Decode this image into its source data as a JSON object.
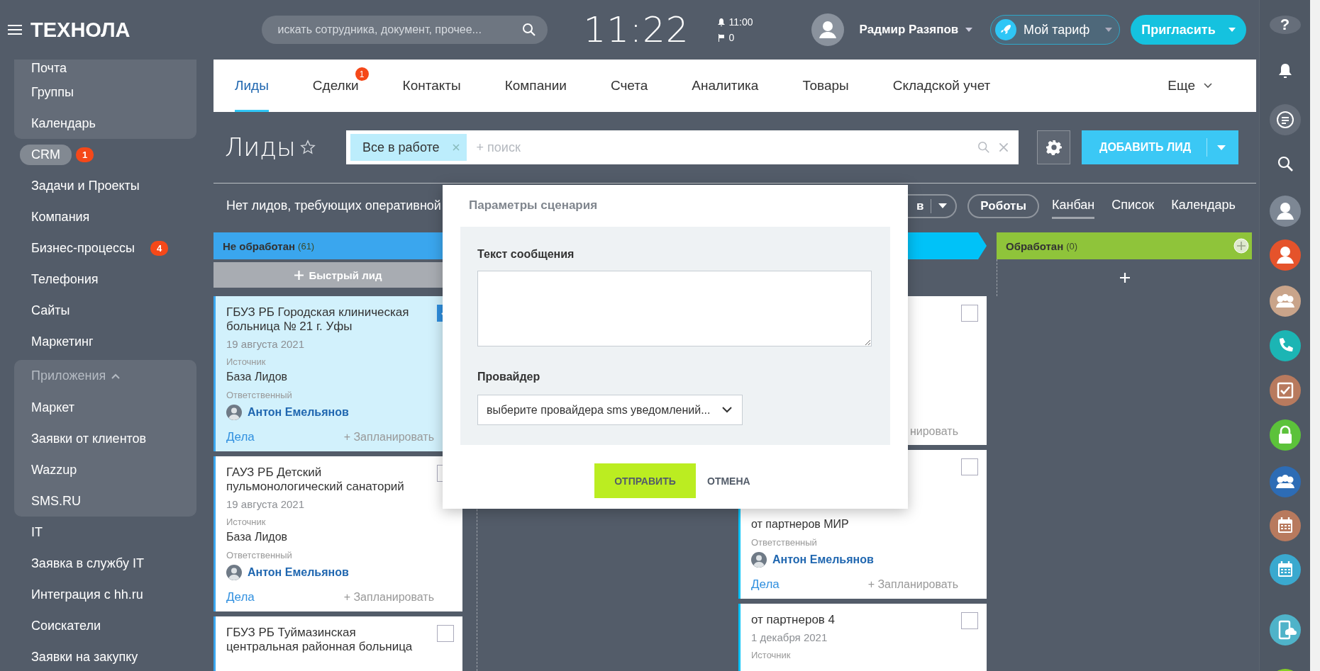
{
  "header": {
    "logo": "ТЕХНОЛА",
    "search": {
      "placeholder": "искать сотрудника, документ, прочее..."
    },
    "clock": "11:22",
    "alarm": "11:00",
    "flags": "0",
    "user": "Радмир Разяпов",
    "tariff": "Мой тариф",
    "invite": "Пригласить",
    "help": "?"
  },
  "sidebar": {
    "sections": [
      {
        "boxed": true,
        "items": [
          {
            "label": "Почта",
            "selected": false
          },
          {
            "label": "Группы",
            "selected": false
          },
          {
            "label": "Календарь",
            "selected": false
          }
        ]
      },
      {
        "boxed": false,
        "items": [
          {
            "label": "CRM",
            "selected": true,
            "badge": "1"
          },
          {
            "label": "Задачи и Проекты",
            "selected": false
          },
          {
            "label": "Компания",
            "selected": false
          },
          {
            "label": "Бизнес-процессы",
            "selected": false,
            "badge": "4"
          },
          {
            "label": "Телефония",
            "selected": false
          },
          {
            "label": "Сайты",
            "selected": false
          },
          {
            "label": "Маркетинг",
            "selected": false
          }
        ]
      },
      {
        "boxed": true,
        "title": "Приложения",
        "expanded": true,
        "items": [
          {
            "label": "Маркет",
            "selected": false
          },
          {
            "label": "Заявки от клиентов",
            "selected": false
          },
          {
            "label": "Wazzup",
            "selected": false
          },
          {
            "label": "SMS.RU",
            "selected": false
          }
        ]
      },
      {
        "boxed": false,
        "items": [
          {
            "label": "IT",
            "selected": false
          },
          {
            "label": "Заявка в службу IT",
            "selected": false
          },
          {
            "label": "Интеграция с hh.ru",
            "selected": false
          },
          {
            "label": "Соискатели",
            "selected": false
          },
          {
            "label": "Заявки на закупку",
            "selected": false
          }
        ]
      }
    ]
  },
  "tabs": [
    {
      "label": "Лиды",
      "selected": true
    },
    {
      "label": "Сделки",
      "selected": false,
      "badge": "1"
    },
    {
      "label": "Контакты",
      "selected": false
    },
    {
      "label": "Компании",
      "selected": false
    },
    {
      "label": "Счета",
      "selected": false
    },
    {
      "label": "Аналитика",
      "selected": false
    },
    {
      "label": "Товары",
      "selected": false
    },
    {
      "label": "Складской учет",
      "selected": false
    }
  ],
  "more": "Еще",
  "page": {
    "title": "Лиды",
    "filter": {
      "chip": "Все в работе",
      "placeholder": "+ поиск"
    },
    "add_button": "ДОБАВИТЬ ЛИД"
  },
  "toolbar": {
    "notice": "Нет лидов, требующих оперативной",
    "dropdown": "в",
    "robots": "Роботы",
    "views": [
      {
        "label": "Канбан",
        "selected": true
      },
      {
        "label": "Список",
        "selected": false
      },
      {
        "label": "Календарь",
        "selected": false
      }
    ]
  },
  "columns": [
    {
      "kind": "stage",
      "title": "Не обработан",
      "count": "(61)",
      "color": "#3aa6ee",
      "quick_add": "Быстрый лид",
      "cards": [
        {
          "title": "ГБУЗ РБ Городская клиническая больница № 21 г. Уфы",
          "date": "19 августа 2021",
          "source_label": "Источник",
          "source": "База Лидов",
          "responsible_label": "Ответственный",
          "person": "Антон Емельянов",
          "deals": "Дела",
          "plan": "+ Запланировать",
          "checked": true
        },
        {
          "title": "ГАУЗ РБ Детский пульмонологический санаторий",
          "date": "19 августа 2021",
          "source_label": "Источник",
          "source": "База Лидов",
          "responsible_label": "Ответственный",
          "person": "Антон Емельянов",
          "deals": "Дела",
          "plan": "+ Запланировать",
          "checked": false
        },
        {
          "title": "ГБУЗ РБ Туймазинская центральная районная больница",
          "checked": false
        }
      ]
    },
    {
      "kind": "stage"
    },
    {
      "kind": "stage",
      "color": "#00c2f8",
      "cards": [
        {
          "plan": "нировать",
          "checked": false
        },
        {
          "source": "от партнеров МИР",
          "responsible_label": "Ответственный",
          "person": "Антон Емельянов",
          "deals": "Дела",
          "plan": "+ Запланировать",
          "checked": false
        },
        {
          "title": "от партнеров 4",
          "date": "1 декабря 2021",
          "source_label": "Источник",
          "checked": false
        }
      ]
    },
    {
      "kind": "final",
      "title": "Обработан",
      "count": "(0)",
      "color": "#8fc43a",
      "add_icon": true
    }
  ],
  "modal": {
    "title": "Параметры сценария",
    "message_label": "Текст сообщения",
    "provider_label": "Провайдер",
    "provider_value": "выберите провайдера sms уведомлений...",
    "send": "ОТПРАВИТЬ",
    "cancel": "ОТМЕНА"
  }
}
